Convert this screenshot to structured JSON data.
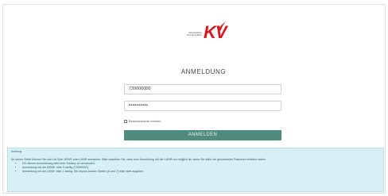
{
  "logo": {
    "org_line1": "Kassenärztliche",
    "org_line2": "Vereinigung Berlin",
    "mark": "KV"
  },
  "login": {
    "title": "ANMELDUNG",
    "username_value": "720000000",
    "password_value": "••••••••••",
    "remember_label": "Benutzername merken",
    "submit_label": "ANMELDEN"
  },
  "notice": {
    "title": "Achtung",
    "text": "An dieser Stelle können Sie sich mit Ihrer BSNR oder LANR anmelden. Bitte beachten Sie, dass eine Anmeldung mit der LANR nur möglich ist, wenn Sie dafür ein gesondertes Passwort erhalten haben.",
    "items": [
      "Für diesen Anmeldeweg bitte kein Yubikey zu verwenden.",
      "Anmeldung mit der BSNR: bitte 9-stellig (72000000).",
      "Anmeldung mit der LANR: bitte 7-stellig. Die letzten beiden Stellen (6 und 7) bitte nicht angeben."
    ]
  },
  "colors": {
    "brand_red": "#d71920",
    "button_green": "#4e8b7d",
    "notice_bg": "#d6f0f6"
  }
}
